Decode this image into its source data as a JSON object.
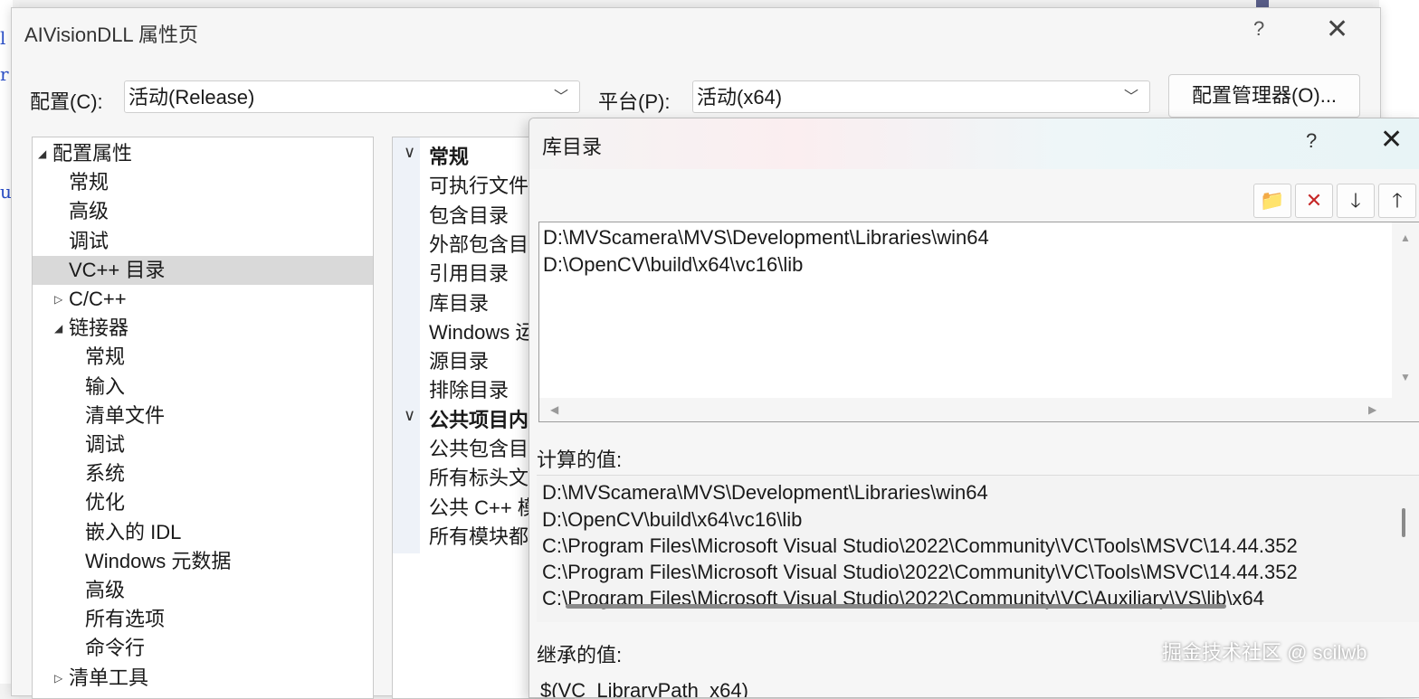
{
  "dialog": {
    "title": "AIVisionDLL 属性页",
    "help_glyph": "?",
    "close_glyph": "✕",
    "config_label": "配置(C):",
    "config_value": "活动(Release)",
    "platform_label": "平台(P):",
    "platform_value": "活动(x64)",
    "config_manager_button": "配置管理器(O)..."
  },
  "tree": {
    "items": [
      {
        "label": "配置属性",
        "level": 0,
        "expander": "expanded"
      },
      {
        "label": "常规",
        "level": 1
      },
      {
        "label": "高级",
        "level": 1
      },
      {
        "label": "调试",
        "level": 1
      },
      {
        "label": "VC++ 目录",
        "level": 1,
        "selected": true
      },
      {
        "label": "C/C++",
        "level": 1,
        "expander": "collapsed"
      },
      {
        "label": "链接器",
        "level": 1,
        "expander": "expanded"
      },
      {
        "label": "常规",
        "level": 2
      },
      {
        "label": "输入",
        "level": 2
      },
      {
        "label": "清单文件",
        "level": 2
      },
      {
        "label": "调试",
        "level": 2
      },
      {
        "label": "系统",
        "level": 2
      },
      {
        "label": "优化",
        "level": 2
      },
      {
        "label": "嵌入的 IDL",
        "level": 2
      },
      {
        "label": "Windows 元数据",
        "level": 2
      },
      {
        "label": "高级",
        "level": 2
      },
      {
        "label": "所有选项",
        "level": 2
      },
      {
        "label": "命令行",
        "level": 2
      },
      {
        "label": "清单工具",
        "level": 1,
        "expander": "collapsed"
      }
    ]
  },
  "property_grid": {
    "items": [
      {
        "label": "常规",
        "category": true
      },
      {
        "label": "可执行文件"
      },
      {
        "label": "包含目录"
      },
      {
        "label": "外部包含目"
      },
      {
        "label": "引用目录"
      },
      {
        "label": "库目录"
      },
      {
        "label": "Windows 运"
      },
      {
        "label": "源目录"
      },
      {
        "label": "排除目录"
      },
      {
        "label": "公共项目内",
        "category": true
      },
      {
        "label": "公共包含目"
      },
      {
        "label": "所有标头文"
      },
      {
        "label": "公共 C++ 模"
      },
      {
        "label": "所有模块都"
      }
    ]
  },
  "lib_dialog": {
    "title": "库目录",
    "help_glyph": "?",
    "close_glyph": "✕",
    "toolbar": {
      "new_line_icon": "new-folder-icon",
      "delete_icon": "delete-icon",
      "move_down_icon": "arrow-down-icon",
      "move_up_icon": "arrow-up-icon",
      "new_line_glyph": "📁",
      "delete_glyph": "✕",
      "move_down_glyph": "🡓",
      "move_up_glyph": "🡑"
    },
    "entries": [
      "D:\\MVScamera\\MVS\\Development\\Libraries\\win64",
      "D:\\OpenCV\\build\\x64\\vc16\\lib"
    ],
    "computed_label": "计算的值:",
    "computed_values": [
      "D:\\MVScamera\\MVS\\Development\\Libraries\\win64",
      "D:\\OpenCV\\build\\x64\\vc16\\lib",
      "C:\\Program Files\\Microsoft Visual Studio\\2022\\Community\\VC\\Tools\\MSVC\\14.44.352",
      "C:\\Program Files\\Microsoft Visual Studio\\2022\\Community\\VC\\Tools\\MSVC\\14.44.352",
      "C:\\Program Files\\Microsoft Visual Studio\\2022\\Community\\VC\\Auxiliary\\VS\\lib\\x64"
    ],
    "inherited_label": "继承的值:",
    "inherited_values": [
      "$(VC_LibraryPath_x64)"
    ]
  },
  "watermark": "掘金技术社区 @ scilwb",
  "colors": {
    "dialog_bg": "#f6f6f6",
    "selection": "#d9d9d9",
    "delete_red": "#c62828",
    "folder_gold": "#c68e17"
  }
}
